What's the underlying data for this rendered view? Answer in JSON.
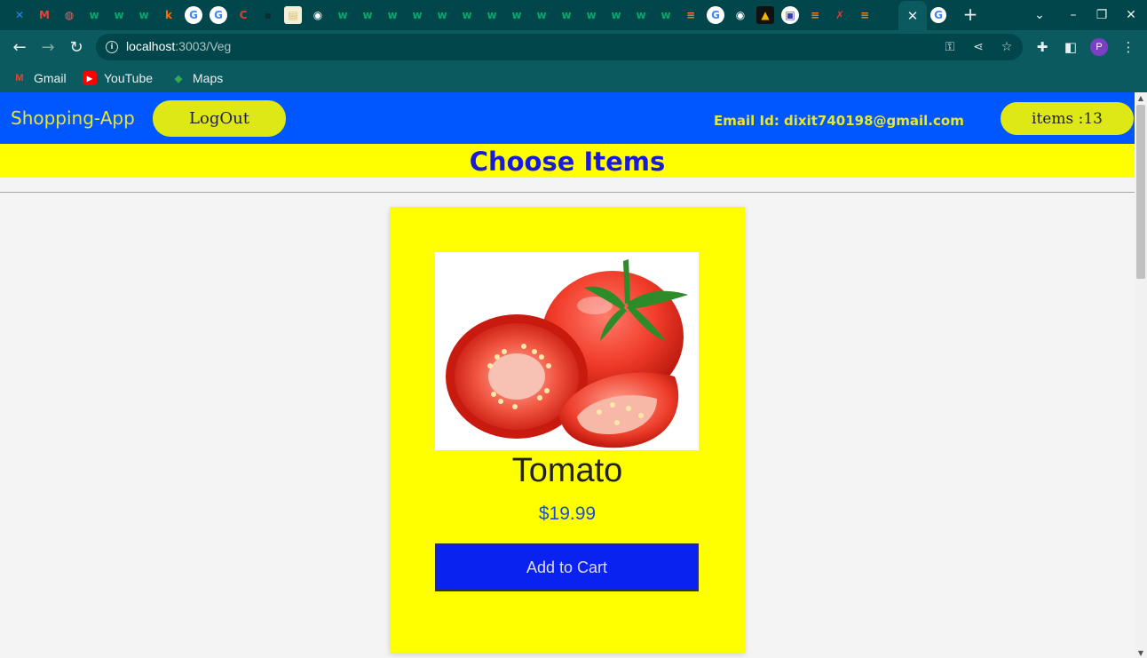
{
  "browser": {
    "tab_icons": [
      {
        "icon": "confluence-icon",
        "glyph": "✕",
        "color": "#2684ff",
        "bg": "transparent"
      },
      {
        "icon": "gmail-icon",
        "glyph": "M",
        "color": "#ea4335",
        "bg": "transparent"
      },
      {
        "icon": "globe-icon",
        "glyph": "◍",
        "color": "#e06666",
        "bg": "transparent"
      },
      {
        "icon": "w3schools-icon",
        "glyph": "w",
        "color": "#04aa6d",
        "bg": "transparent"
      },
      {
        "icon": "w3schools-icon",
        "glyph": "w",
        "color": "#04aa6d",
        "bg": "transparent"
      },
      {
        "icon": "w3schools-icon",
        "glyph": "w",
        "color": "#04aa6d",
        "bg": "transparent"
      },
      {
        "icon": "k-icon",
        "glyph": "k",
        "color": "#ff6a00",
        "bg": "transparent"
      },
      {
        "icon": "google-icon",
        "glyph": "G",
        "color": "#4285f4",
        "bg": "#ffffff"
      },
      {
        "icon": "google-icon",
        "glyph": "G",
        "color": "#4285f4",
        "bg": "#ffffff"
      },
      {
        "icon": "c-icon",
        "glyph": "C",
        "color": "#e53935",
        "bg": "transparent"
      },
      {
        "icon": "dark-site-icon",
        "glyph": "▪",
        "color": "#063033",
        "bg": "transparent"
      },
      {
        "icon": "notes-icon",
        "glyph": "▤",
        "color": "#d9c070",
        "bg": "#f4f0d8"
      },
      {
        "icon": "chrome-icon",
        "glyph": "◉",
        "color": "#ffffff",
        "bg": "transparent"
      },
      {
        "icon": "w3schools-icon",
        "glyph": "w",
        "color": "#04aa6d",
        "bg": "transparent"
      },
      {
        "icon": "w3schools-icon",
        "glyph": "w",
        "color": "#04aa6d",
        "bg": "transparent"
      },
      {
        "icon": "w3schools-icon",
        "glyph": "w",
        "color": "#04aa6d",
        "bg": "transparent"
      },
      {
        "icon": "w3schools-icon",
        "glyph": "w",
        "color": "#04aa6d",
        "bg": "transparent"
      },
      {
        "icon": "w3schools-icon",
        "glyph": "w",
        "color": "#04aa6d",
        "bg": "transparent"
      },
      {
        "icon": "w3schools-icon",
        "glyph": "w",
        "color": "#04aa6d",
        "bg": "transparent"
      },
      {
        "icon": "w3schools-icon",
        "glyph": "w",
        "color": "#04aa6d",
        "bg": "transparent"
      },
      {
        "icon": "w3schools-icon",
        "glyph": "w",
        "color": "#04aa6d",
        "bg": "transparent"
      },
      {
        "icon": "w3schools-icon",
        "glyph": "w",
        "color": "#04aa6d",
        "bg": "transparent"
      },
      {
        "icon": "w3schools-icon",
        "glyph": "w",
        "color": "#04aa6d",
        "bg": "transparent"
      },
      {
        "icon": "w3schools-icon",
        "glyph": "w",
        "color": "#04aa6d",
        "bg": "transparent"
      },
      {
        "icon": "w3schools-icon",
        "glyph": "w",
        "color": "#04aa6d",
        "bg": "transparent"
      },
      {
        "icon": "w3schools-icon",
        "glyph": "w",
        "color": "#04aa6d",
        "bg": "transparent"
      },
      {
        "icon": "w3schools-icon",
        "glyph": "w",
        "color": "#04aa6d",
        "bg": "transparent"
      },
      {
        "icon": "stackoverflow-icon",
        "glyph": "≡",
        "color": "#f48024",
        "bg": "transparent"
      },
      {
        "icon": "google-icon",
        "glyph": "G",
        "color": "#4285f4",
        "bg": "#ffffff"
      },
      {
        "icon": "chrome-icon",
        "glyph": "◉",
        "color": "#ffffff",
        "bg": "transparent"
      },
      {
        "icon": "warning-site-icon",
        "glyph": "▲",
        "color": "#f4b400",
        "bg": "#111111"
      },
      {
        "icon": "image-site-icon",
        "glyph": "▣",
        "color": "#3b3bbb",
        "bg": "#ffffff"
      },
      {
        "icon": "stackoverflow-icon",
        "glyph": "≡",
        "color": "#f48024",
        "bg": "transparent"
      },
      {
        "icon": "red-figure-icon",
        "glyph": "✗",
        "color": "#e53935",
        "bg": "transparent"
      },
      {
        "icon": "stackoverflow-icon",
        "glyph": "≡",
        "color": "#f48024",
        "bg": "transparent"
      }
    ],
    "active_tab_close": "✕",
    "url_host": "localhost",
    "url_path": ":3003/Veg",
    "bookmarks": [
      {
        "label": "Gmail",
        "icon": "gmail-icon"
      },
      {
        "label": "YouTube",
        "icon": "youtube-icon"
      },
      {
        "label": "Maps",
        "icon": "maps-icon"
      }
    ]
  },
  "app": {
    "brand": "Shopping-App",
    "logout_label": "LogOut",
    "email": "Email Id: dixit740198@gmail.com",
    "items_label": "items :13",
    "heading": "Choose Items"
  },
  "product": {
    "name": "Tomato",
    "price": "$19.99",
    "button_label": "Add to Cart"
  },
  "colors": {
    "navbar_bg": "#0057ff",
    "accent_yellow": "#ffff00",
    "pill_yellow": "#dde815",
    "heading_blue": "#1a1adb",
    "button_blue": "#0a22f0"
  }
}
